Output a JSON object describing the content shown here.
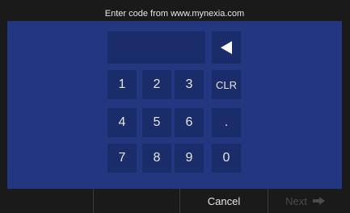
{
  "header": {
    "title": "Enter code from www.mynexia.com"
  },
  "code_input": {
    "value": ""
  },
  "keypad": {
    "backspace_icon": "backspace-left-triangle-icon",
    "keys": [
      "1",
      "2",
      "3",
      "CLR",
      "4",
      "5",
      "6",
      ".",
      "7",
      "8",
      "9",
      "0"
    ]
  },
  "bottom_bar": {
    "cancel_label": "Cancel",
    "next_label": "Next",
    "next_icon": "arrow-right-icon"
  },
  "colors": {
    "panel": "#223780",
    "key": "#1b2c6a",
    "bar": "#1a1a1a",
    "text": "#e6e6e6",
    "disabled": "#4a4a4a"
  }
}
